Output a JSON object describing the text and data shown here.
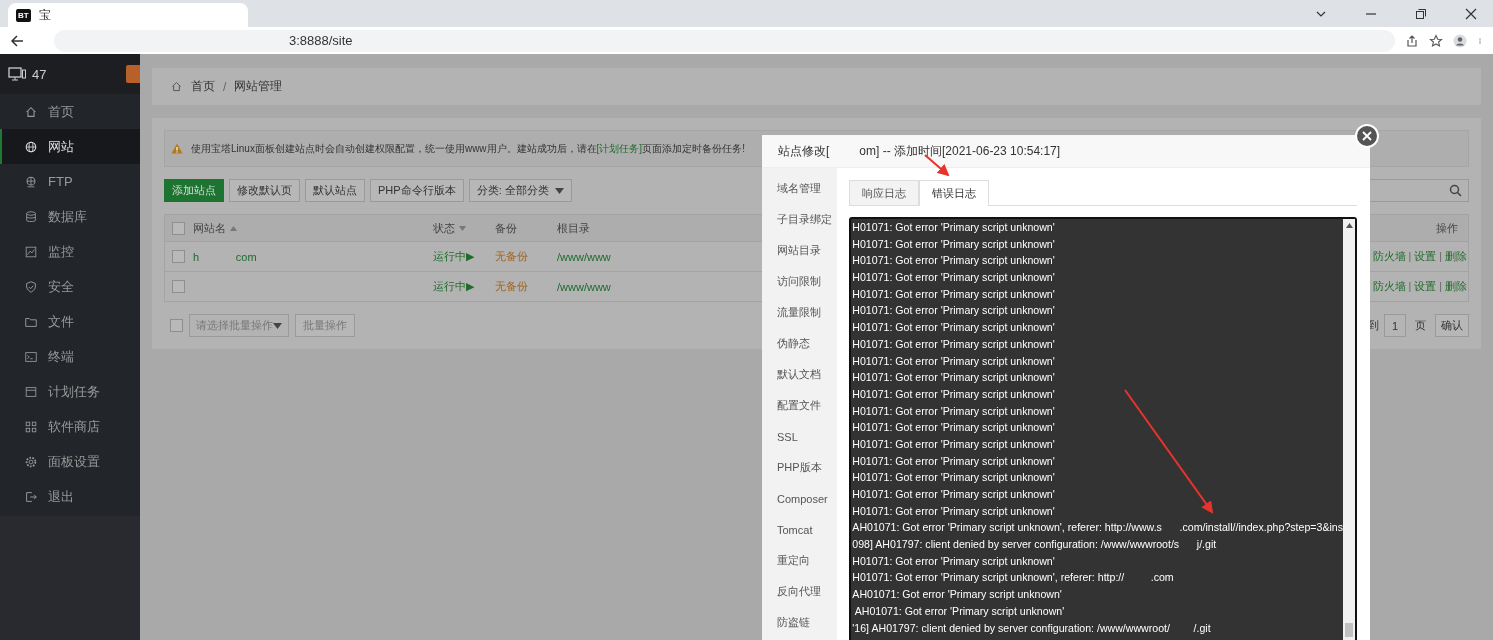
{
  "browser": {
    "favicon": "BT",
    "tab_title": "宝",
    "url": "3:8888/site"
  },
  "sidebar": {
    "server_label": "47",
    "items": [
      {
        "label": "首页",
        "selected": false
      },
      {
        "label": "网站",
        "selected": true
      },
      {
        "label": "FTP",
        "selected": false
      },
      {
        "label": "数据库",
        "selected": false
      },
      {
        "label": "监控",
        "selected": false
      },
      {
        "label": "安全",
        "selected": false
      },
      {
        "label": "文件",
        "selected": false
      },
      {
        "label": "终端",
        "selected": false
      },
      {
        "label": "计划任务",
        "selected": false
      },
      {
        "label": "软件商店",
        "selected": false
      },
      {
        "label": "面板设置",
        "selected": false
      },
      {
        "label": "退出",
        "selected": false
      }
    ]
  },
  "breadcrumb": {
    "items": [
      "首页",
      "网站管理"
    ],
    "separator": "/"
  },
  "notice": {
    "text": "使用宝塔Linux面板创建站点时会自动创建权限配置，统一使用www用户。建站成功后，请在",
    "link": "[计划任务]",
    "text_after": "页面添加定时备份任务!"
  },
  "toolbar": {
    "buttons": [
      {
        "label": "添加站点",
        "kind": "primary"
      },
      {
        "label": "修改默认页",
        "kind": "default"
      },
      {
        "label": "默认站点",
        "kind": "default"
      },
      {
        "label": "PHP命令行版本",
        "kind": "default"
      }
    ],
    "category": "分类: 全部分类"
  },
  "table": {
    "header_checked": false,
    "columns": [
      "网站名",
      "状态",
      "备份",
      "根目录",
      "操作"
    ],
    "action_separator": "|",
    "rows": [
      {
        "checked": false,
        "name": "h            com",
        "status": "运行中▶",
        "backup": "无备份",
        "path": "/www/www",
        "actions": [
          "防火墙",
          "设置",
          "删除"
        ]
      },
      {
        "checked": false,
        "name": "",
        "status": "运行中▶",
        "backup": "无备份",
        "path": "/www/www",
        "actions": [
          "防火墙",
          "设置",
          "删除"
        ]
      }
    ]
  },
  "footer": {
    "checked": false,
    "batch_placeholder": "请选择批量操作",
    "batch_button": "批量操作",
    "goto": "到",
    "page": "1",
    "page_unit": "页",
    "confirm": "确认"
  },
  "modal": {
    "title": "站点修改[         om] -- 添加时间[2021-06-23 10:54:17]",
    "menu": [
      "域名管理",
      "子目录绑定",
      "网站目录",
      "访问限制",
      "流量限制",
      "伪静态",
      "默认文档",
      "配置文件",
      "SSL",
      "PHP版本",
      "Composer",
      "Tomcat",
      "重定向",
      "反向代理",
      "防盗链"
    ],
    "tabs": [
      {
        "label": "响应日志",
        "selected": false
      },
      {
        "label": "错误日志",
        "selected": true
      }
    ],
    "log_lines": [
      "H01071: Got error 'Primary script unknown'",
      "H01071: Got error 'Primary script unknown'",
      "H01071: Got error 'Primary script unknown'",
      "H01071: Got error 'Primary script unknown'",
      "H01071: Got error 'Primary script unknown'",
      "H01071: Got error 'Primary script unknown'",
      "H01071: Got error 'Primary script unknown'",
      "H01071: Got error 'Primary script unknown'",
      "H01071: Got error 'Primary script unknown'",
      "H01071: Got error 'Primary script unknown'",
      "H01071: Got error 'Primary script unknown'",
      "H01071: Got error 'Primary script unknown'",
      "H01071: Got error 'Primary script unknown'",
      "H01071: Got error 'Primary script unknown'",
      "H01071: Got error 'Primary script unknown'",
      "H01071: Got error 'Primary script unknown'",
      "H01071: Got error 'Primary script unknown'",
      "H01071: Got error 'Primary script unknown'",
      "AH01071: Got error 'Primary script unknown', referer: http://www.s      .com/install//index.php?step=3&ins",
      "098] AH01797: client denied by server configuration: /www/wwwroot/s      j/.git",
      "H01071: Got error 'Primary script unknown'",
      "H01071: Got error 'Primary script unknown', referer: http://         .com",
      "AH01071: Got error 'Primary script unknown'",
      " AH01071: Got error 'Primary script unknown'",
      "'16] AH01797: client denied by server configuration: /www/wwwroot/        /.git"
    ]
  }
}
